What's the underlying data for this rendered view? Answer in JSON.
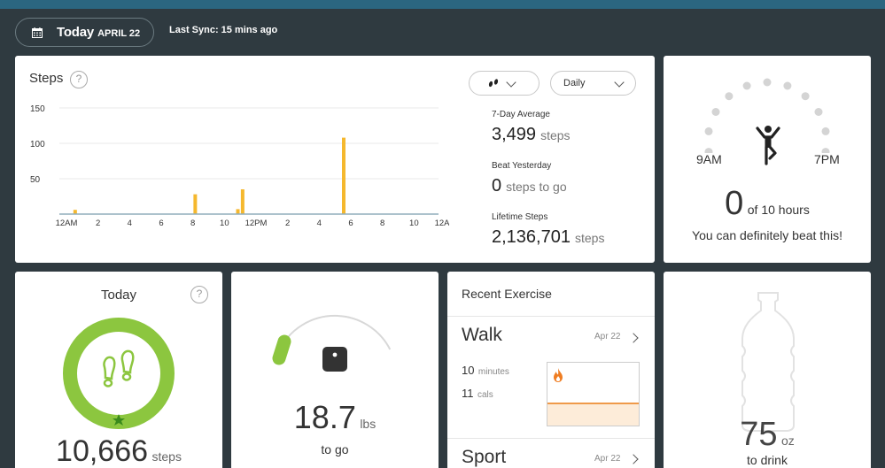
{
  "header": {
    "today_word": "Today",
    "today_date": "APRIL 22",
    "last_sync": "Last Sync: 15 mins ago"
  },
  "steps": {
    "title": "Steps",
    "help": "?",
    "type_dropdown_icon": "footsteps-icon",
    "period_dropdown": "Daily",
    "stats": {
      "avg_label": "7-Day Average",
      "avg_value": "3,499",
      "avg_unit": "steps",
      "beat_label": "Beat Yesterday",
      "beat_value": "0",
      "beat_unit": "steps to go",
      "lifetime_label": "Lifetime Steps",
      "lifetime_value": "2,136,701",
      "lifetime_unit": "steps"
    }
  },
  "chart_data": {
    "type": "bar",
    "ylim": [
      0,
      150
    ],
    "yticks": [
      50,
      100,
      150
    ],
    "xticks": [
      "12AM",
      "2",
      "4",
      "6",
      "8",
      "10",
      "12PM",
      "2",
      "4",
      "6",
      "8",
      "10",
      "12AM"
    ],
    "x_hours": [
      1.0,
      8.6,
      11.3,
      11.6,
      18.0
    ],
    "values": [
      6,
      28,
      7,
      35,
      108
    ],
    "color": "#f5b82e"
  },
  "active_hours": {
    "start_label": "9AM",
    "end_label": "7PM",
    "value": "0",
    "of_text": "of 10 hours",
    "message": "You can definitely beat this!",
    "dots_total": 11,
    "icon": "active-person-icon"
  },
  "goal": {
    "title": "Today",
    "help": "?",
    "value": "10,666",
    "unit": "steps",
    "progress": 1.0,
    "ring_color": "#8cc63f",
    "icon": "footsteps-icon"
  },
  "weight": {
    "value": "18.7",
    "unit": "lbs",
    "label": "to go",
    "progress": 0.02,
    "icon": "scale-icon"
  },
  "exercise": {
    "title": "Recent Exercise",
    "items": [
      {
        "name": "Walk",
        "date": "Apr 22",
        "duration": "10",
        "duration_unit": "minutes",
        "cals": "11",
        "cals_unit": "cals"
      },
      {
        "name": "Sport",
        "date": "Apr 22"
      }
    ]
  },
  "water": {
    "value": "75",
    "unit": "oz",
    "label": "to drink",
    "icon": "water-bottle-icon"
  }
}
